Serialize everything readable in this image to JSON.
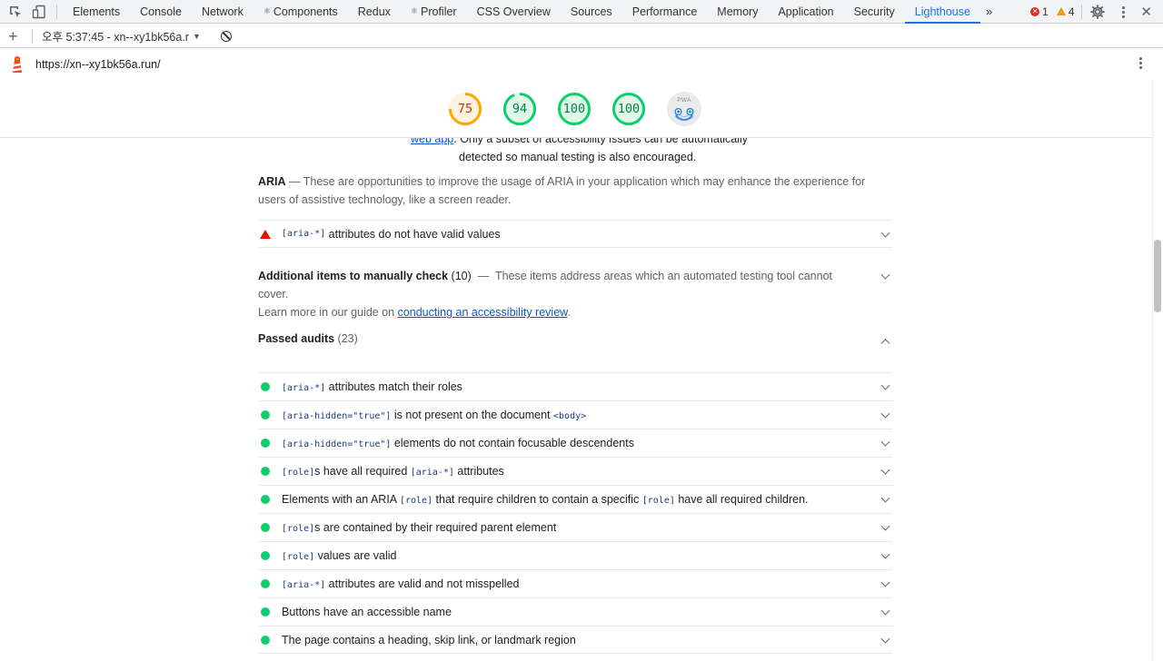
{
  "devtools": {
    "tabs": [
      {
        "label": "Elements",
        "prefix": ""
      },
      {
        "label": "Console",
        "prefix": ""
      },
      {
        "label": "Network",
        "prefix": ""
      },
      {
        "label": "Components",
        "prefix": "⚛"
      },
      {
        "label": "Redux",
        "prefix": ""
      },
      {
        "label": "Profiler",
        "prefix": "⚛"
      },
      {
        "label": "CSS Overview",
        "prefix": ""
      },
      {
        "label": "Sources",
        "prefix": ""
      },
      {
        "label": "Performance",
        "prefix": ""
      },
      {
        "label": "Memory",
        "prefix": ""
      },
      {
        "label": "Application",
        "prefix": ""
      },
      {
        "label": "Security",
        "prefix": ""
      },
      {
        "label": "Lighthouse",
        "prefix": ""
      }
    ],
    "active_tab": "Lighthouse",
    "more_tabs": "»",
    "error_count": "1",
    "warning_count": "4"
  },
  "lighthouse_toolbar": {
    "add_label": "+",
    "report_label": "오후 5:37:45 - xn--xy1bk56a.r",
    "caret": "▼"
  },
  "url_bar": {
    "url": "https://xn--xy1bk56a.run/"
  },
  "scores": [
    {
      "value": 75,
      "label": "75",
      "color": "#ffa400",
      "track": "#fff3e0",
      "text": "#c33300"
    },
    {
      "value": 94,
      "label": "94",
      "color": "#0cce6b",
      "track": "#e0f7ea",
      "text": "#018642"
    },
    {
      "value": 100,
      "label": "100",
      "color": "#0cce6b",
      "track": "#e0f7ea",
      "text": "#018642"
    },
    {
      "value": 100,
      "label": "100",
      "color": "#0cce6b",
      "track": "#e0f7ea",
      "text": "#018642"
    }
  ],
  "pwa_label": "PWA",
  "intro": {
    "link": "web app",
    "text1": ". Only a subset of accessibility issues can be automatically",
    "text2": "detected so manual testing is also encouraged."
  },
  "aria_group": {
    "title": "ARIA",
    "dash": " — ",
    "description": "These are opportunities to improve the usage of ARIA in your application which may enhance the experience for users of assistive technology, like a screen reader."
  },
  "failed_audit": {
    "code": "[aria-*]",
    "text": " attributes do not have valid values"
  },
  "manual": {
    "title": "Additional items to manually check",
    "count": " (10)",
    "dash": "  —  ",
    "description": "These items address areas which an automated testing tool cannot cover.",
    "learn_prefix": "Learn more in our guide on ",
    "learn_link": "conducting an accessibility review",
    "learn_suffix": "."
  },
  "passed": {
    "title": "Passed audits",
    "count": " (23)",
    "items": [
      {
        "parts": [
          {
            "code": "[aria-*]"
          },
          {
            "text": " attributes match their roles"
          }
        ]
      },
      {
        "parts": [
          {
            "code": "[aria-hidden=\"true\"]"
          },
          {
            "text": " is not present on the document "
          },
          {
            "code": "<body>"
          }
        ]
      },
      {
        "parts": [
          {
            "code": "[aria-hidden=\"true\"]"
          },
          {
            "text": " elements do not contain focusable descendents"
          }
        ]
      },
      {
        "parts": [
          {
            "code": "[role]"
          },
          {
            "text": "s have all required "
          },
          {
            "code": "[aria-*]"
          },
          {
            "text": " attributes"
          }
        ]
      },
      {
        "parts": [
          {
            "text": "Elements with an ARIA "
          },
          {
            "code": "[role]"
          },
          {
            "text": " that require children to contain a specific "
          },
          {
            "code": "[role]"
          },
          {
            "text": " have all required children."
          }
        ]
      },
      {
        "parts": [
          {
            "code": "[role]"
          },
          {
            "text": "s are contained by their required parent element"
          }
        ]
      },
      {
        "parts": [
          {
            "code": "[role]"
          },
          {
            "text": " values are valid"
          }
        ]
      },
      {
        "parts": [
          {
            "code": "[aria-*]"
          },
          {
            "text": " attributes are valid and not misspelled"
          }
        ]
      },
      {
        "parts": [
          {
            "text": "Buttons have an accessible name"
          }
        ]
      },
      {
        "parts": [
          {
            "text": "The page contains a heading, skip link, or landmark region"
          }
        ]
      }
    ]
  }
}
